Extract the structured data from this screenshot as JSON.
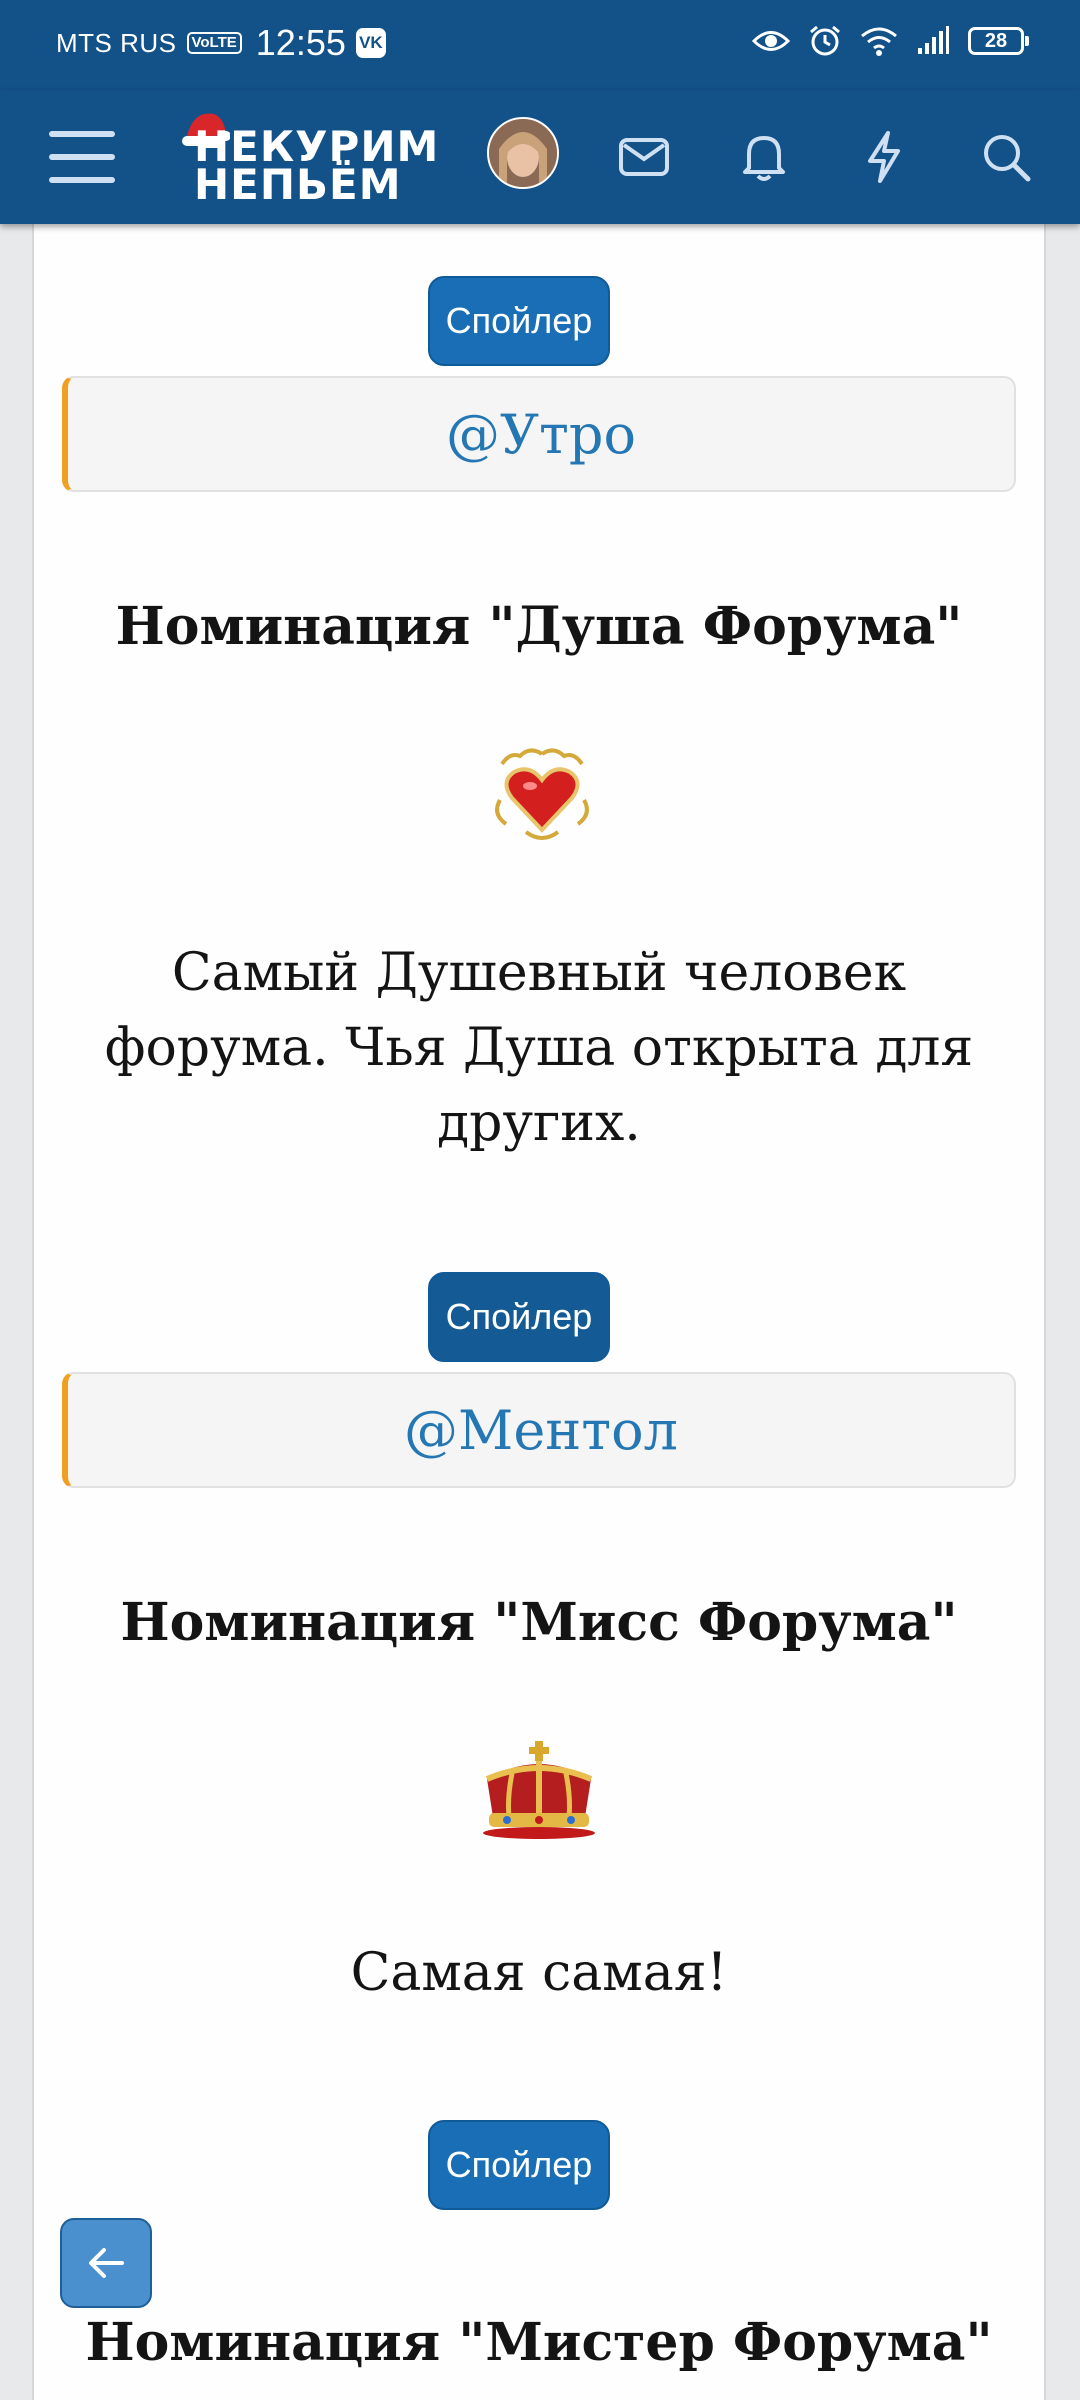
{
  "status_bar": {
    "carrier": "MTS RUS",
    "volte": "VoLTE",
    "time": "12:55",
    "vk": "VK",
    "battery": "28"
  },
  "nav": {
    "logo_line1": "НЕКУРИМ",
    "logo_line2": "НЕПЬЁМ"
  },
  "sections": [
    {
      "spoiler_label": "Спойлер",
      "mention": "@Утро"
    },
    {
      "nomination": "Номинация \"Душа Форума\"",
      "emoji": "heart",
      "description": "Самый Душевный человек форума. Чья Душа открыта для других.",
      "spoiler_label": "Спойлер",
      "mention": "@Ментол"
    },
    {
      "nomination": "Номинация \"Мисс Форума\"",
      "emoji": "crown",
      "description": "Самая самая!",
      "spoiler_label": "Спойлер"
    },
    {
      "nomination": "Номинация \"Мистер Форума\""
    }
  ],
  "colors": {
    "header": "#135189",
    "button": "#1a6eb5",
    "mention": "#2477b3",
    "accent_border": "#f0a020"
  }
}
